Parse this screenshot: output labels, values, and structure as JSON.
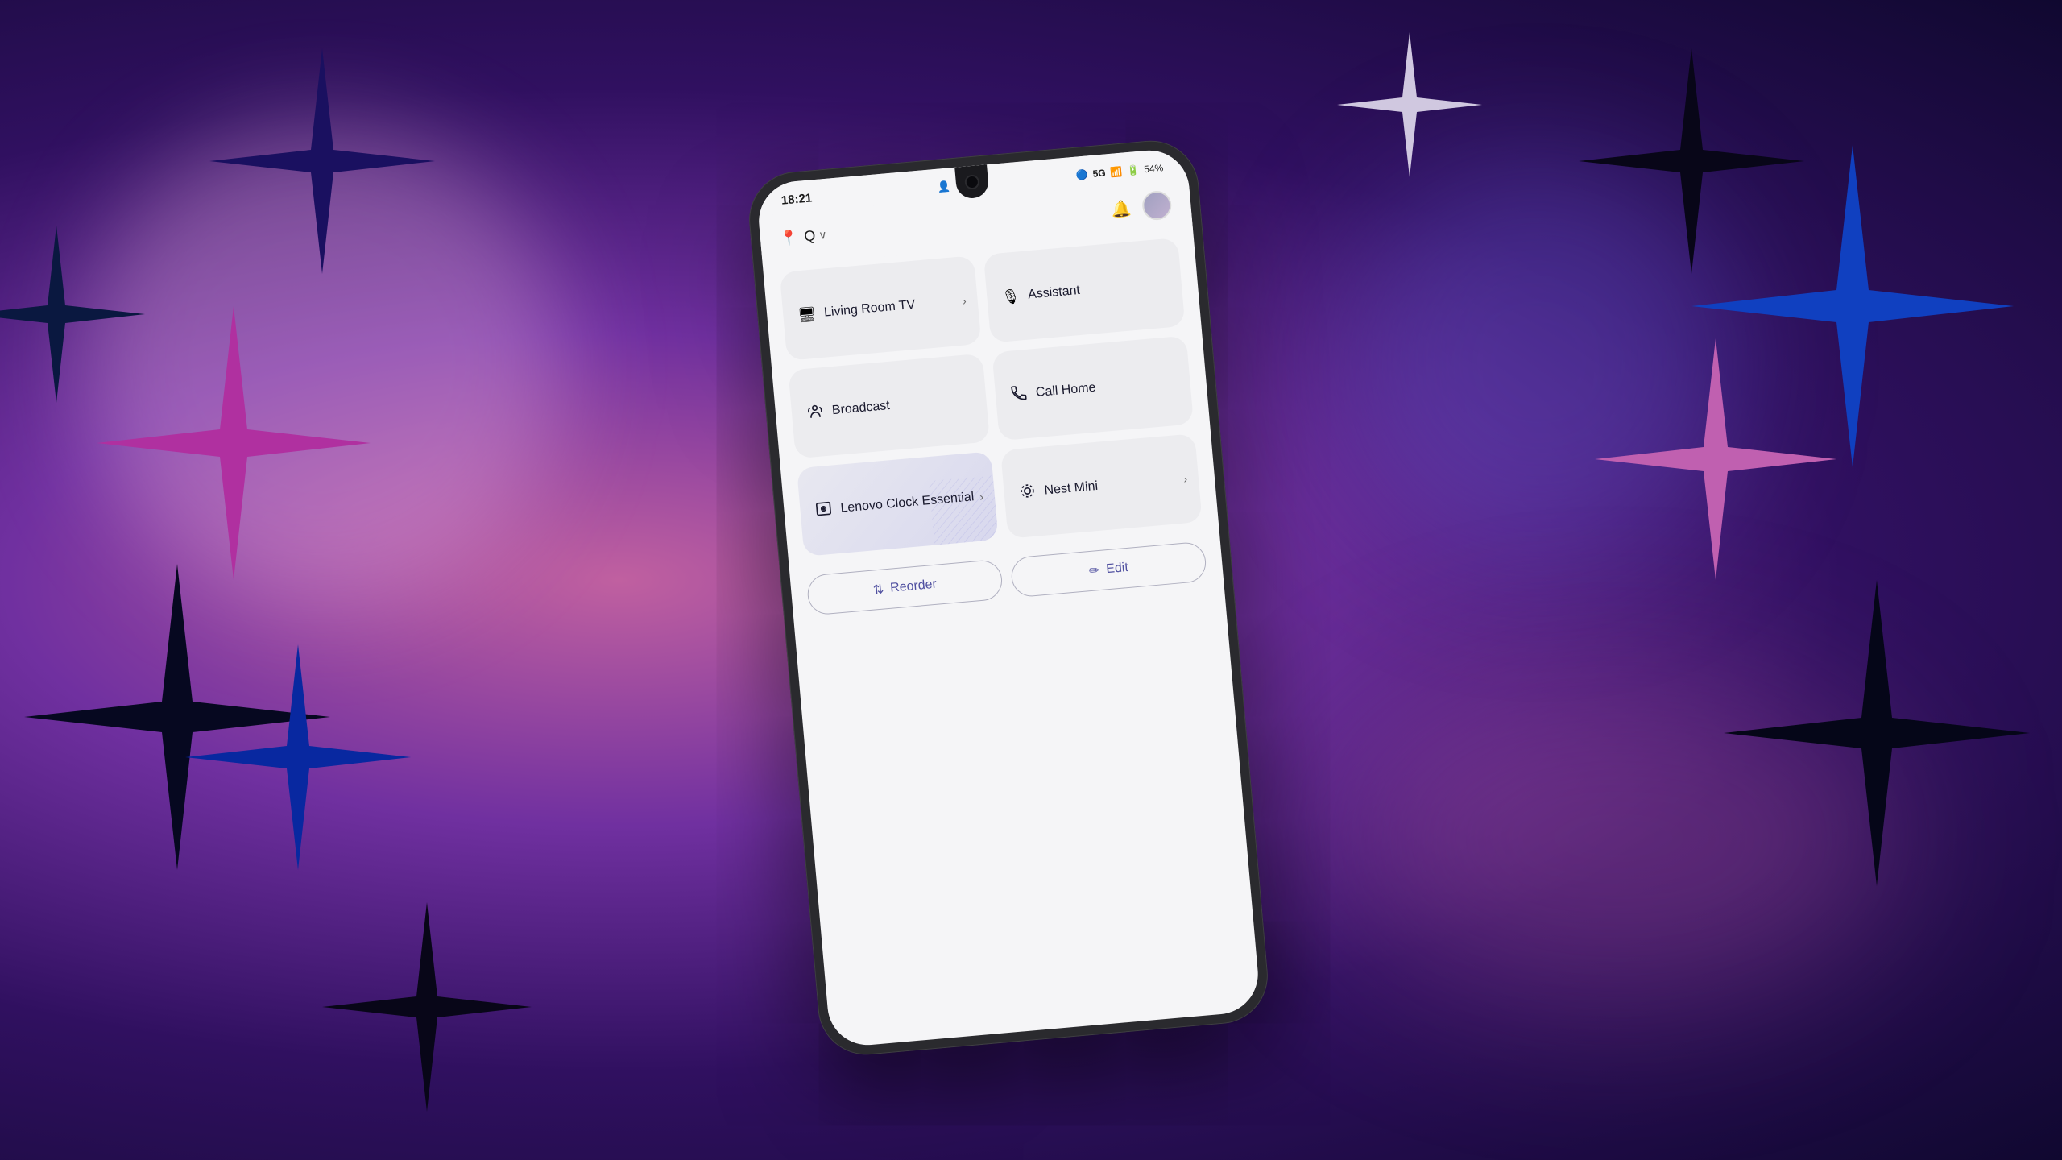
{
  "background": {
    "alt": "Abstract purple background with sparkle stars"
  },
  "phone": {
    "status_bar": {
      "time": "18:21",
      "battery": "54%",
      "network": "5G"
    },
    "header": {
      "location_label": "Q",
      "dropdown_label": "Q ∨",
      "bell_label": "🔔",
      "avatar_alt": "User avatar"
    },
    "cards": [
      {
        "id": "living-room-tv",
        "icon": "⬛",
        "icon_name": "tv-icon",
        "label": "Living Room TV",
        "has_chevron": true
      },
      {
        "id": "assistant",
        "icon": "🎙",
        "icon_name": "mic-icon",
        "label": "Assistant",
        "has_chevron": false
      },
      {
        "id": "broadcast",
        "icon": "👤",
        "icon_name": "broadcast-icon",
        "label": "Broadcast",
        "has_chevron": false,
        "is_active": true
      },
      {
        "id": "call-home",
        "icon": "📞",
        "icon_name": "phone-icon",
        "label": "Call Home",
        "has_chevron": false
      },
      {
        "id": "lenovo-clock",
        "icon": "🔊",
        "icon_name": "speaker-icon",
        "label": "Lenovo Clock Essential",
        "has_chevron": true,
        "is_active": true
      },
      {
        "id": "nest-mini",
        "icon": "🔈",
        "icon_name": "nest-icon",
        "label": "Nest Mini",
        "has_chevron": true
      }
    ],
    "buttons": [
      {
        "id": "reorder",
        "icon": "⇅",
        "label": "Reorder"
      },
      {
        "id": "edit",
        "icon": "✏",
        "label": "Edit"
      }
    ]
  }
}
